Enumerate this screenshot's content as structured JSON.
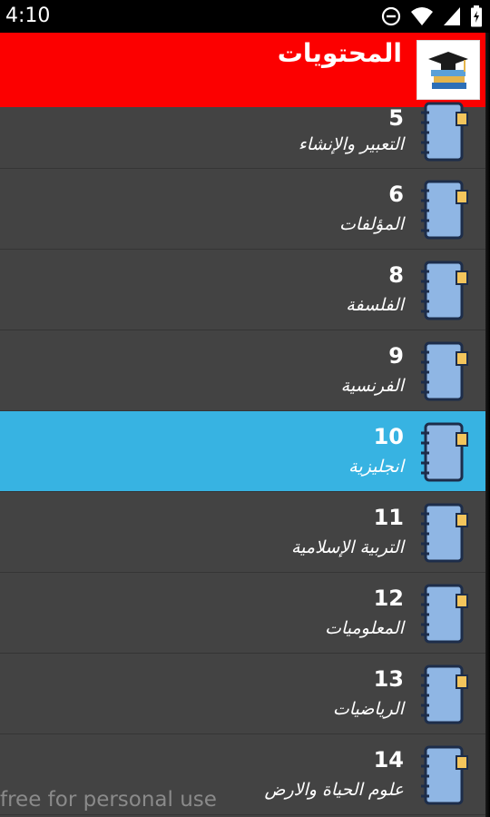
{
  "status": {
    "time": "4:10",
    "icons": [
      "dnd-icon",
      "wifi-icon",
      "signal-icon",
      "battery-icon"
    ]
  },
  "header": {
    "title": "المحتويات",
    "logo_icon": "graduation-books-icon",
    "background": "#fc0000"
  },
  "list": {
    "items": [
      {
        "number": "5",
        "label": "التعبير والإنشاء",
        "selected": false
      },
      {
        "number": "6",
        "label": "المؤلفات",
        "selected": false
      },
      {
        "number": "8",
        "label": "الفلسفة",
        "selected": false
      },
      {
        "number": "9",
        "label": "الفرنسية",
        "selected": false
      },
      {
        "number": "10",
        "label": "انجليزية",
        "selected": true
      },
      {
        "number": "11",
        "label": "التربية الإسلامية",
        "selected": false
      },
      {
        "number": "12",
        "label": "المعلوميات",
        "selected": false
      },
      {
        "number": "13",
        "label": "الرياضيات",
        "selected": false
      },
      {
        "number": "14",
        "label": "علوم الحياة والارض",
        "selected": false
      }
    ],
    "item_icon": "notebook-icon",
    "selected_color": "#37b3e2"
  },
  "watermark": "free for personal use"
}
